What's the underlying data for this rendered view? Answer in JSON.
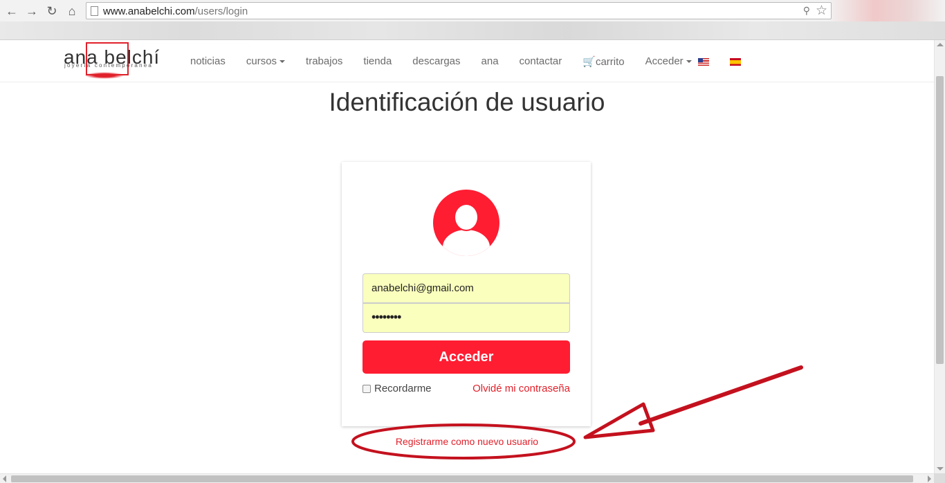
{
  "browser": {
    "back_icon": "arrow-left-icon",
    "forward_icon": "arrow-right-icon",
    "reload_icon": "reload-icon",
    "home_icon": "home-icon",
    "url_host": "www.anabelchi.com",
    "url_path": "/users/login"
  },
  "site": {
    "logo_name": "ana belchí",
    "logo_tagline": "joyería contemporánea",
    "brand_color": "#e0202a",
    "menu": [
      {
        "label": "noticias"
      },
      {
        "label": "cursos",
        "dropdown": true
      },
      {
        "label": "trabajos"
      },
      {
        "label": "tienda"
      },
      {
        "label": "descargas"
      },
      {
        "label": "ana"
      },
      {
        "label": "contactar"
      },
      {
        "label": "carrito",
        "icon": "cart-icon"
      },
      {
        "label": "Acceder",
        "dropdown": true
      }
    ],
    "languages": [
      "en-flag-icon",
      "es-flag-icon"
    ]
  },
  "login": {
    "title": "Identificación de usuario",
    "avatar_icon": "user-avatar-icon",
    "email_value": "anabelchi@gmail.com",
    "password_value": "••••••••",
    "submit_label": "Acceder",
    "remember_label": "Recordarme",
    "remember_checked": false,
    "forgot_label": "Olvidé mi contraseña",
    "register_label": "Registrarme como nuevo usuario",
    "accent_color": "#ff1d32",
    "autofill_color": "#faffbd"
  }
}
